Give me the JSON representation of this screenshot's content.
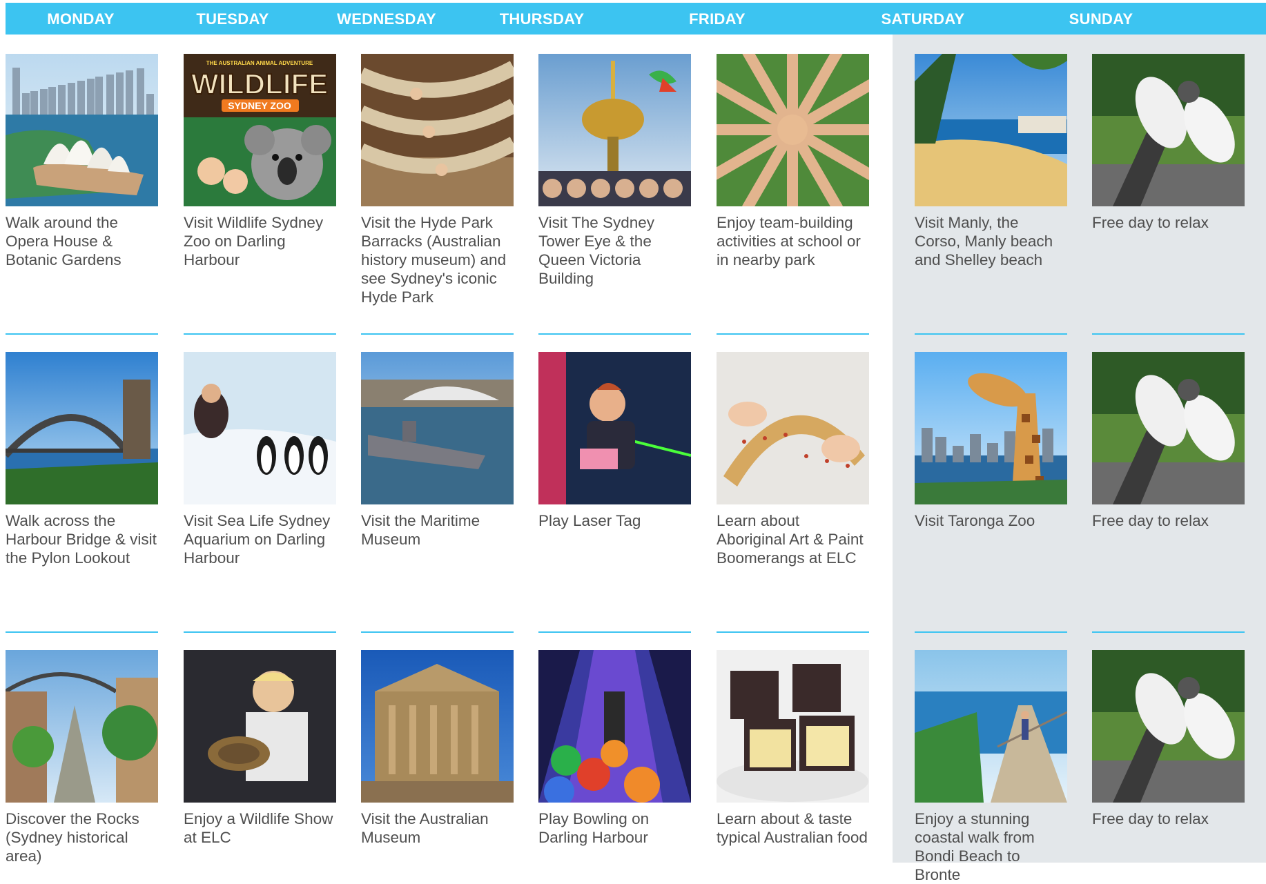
{
  "days": [
    "MONDAY",
    "TUESDAY",
    "WEDNESDAY",
    "THURSDAY",
    "FRIDAY",
    "SATURDAY",
    "SUNDAY"
  ],
  "accent_color": "#3cc4f1",
  "weekend_bg_color": "#e3e7ea",
  "activities": [
    [
      {
        "caption": "Walk around the Opera House & Botanic Gardens",
        "image": "opera-house"
      },
      {
        "caption": "Walk across the Harbour Bridge & visit the Pylon Lookout",
        "image": "harbour-bridge"
      },
      {
        "caption": "Discover the Rocks (Sydney historical area)",
        "image": "the-rocks"
      }
    ],
    [
      {
        "caption": "Visit Wildlife Sydney Zoo on Darling Harbour",
        "image": "wildlife-zoo",
        "poster_title": "WILDLIFE",
        "poster_subtitle": "SYDNEY ZOO",
        "poster_tagline": "THE AUSTRALIAN ANIMAL ADVENTURE"
      },
      {
        "caption": "Visit Sea Life Sydney Aquarium on Darling Harbour",
        "image": "aquarium-penguins"
      },
      {
        "caption": "Enjoy a Wildlife Show at ELC",
        "image": "wildlife-show"
      }
    ],
    [
      {
        "caption": "Visit the Hyde Park Barracks (Australian history museum) and see Sydney's iconic Hyde Park",
        "image": "hammocks"
      },
      {
        "caption": "Visit the Maritime Museum",
        "image": "maritime-museum"
      },
      {
        "caption": "Visit the Australian Museum",
        "image": "australian-museum"
      }
    ],
    [
      {
        "caption": "Visit The Sydney Tower Eye & the Queen Victoria Building",
        "image": "sydney-tower"
      },
      {
        "caption": "Play Laser Tag",
        "image": "laser-tag"
      },
      {
        "caption": "Play Bowling on Darling Harbour",
        "image": "bowling"
      }
    ],
    [
      {
        "caption": "Enjoy team-building activities at school or in nearby park",
        "image": "team-hands"
      },
      {
        "caption": "Learn about Aboriginal Art & Paint Boomerangs at ELC",
        "image": "boomerang"
      },
      {
        "caption": "Learn about & taste typical Australian food",
        "image": "lamingtons"
      }
    ],
    [
      {
        "caption": "Visit Manly, the Corso, Manly beach and Shelley beach",
        "image": "manly-beach"
      },
      {
        "caption": "Visit Taronga Zoo",
        "image": "giraffe"
      },
      {
        "caption": "Enjoy a stunning coastal walk from Bondi Beach to Bronte",
        "image": "coastal-walk"
      }
    ],
    [
      {
        "caption": "Free day to relax",
        "image": "relax-feet"
      },
      {
        "caption": "Free day to relax",
        "image": "relax-feet"
      },
      {
        "caption": "Free day to relax",
        "image": "relax-feet"
      }
    ]
  ]
}
